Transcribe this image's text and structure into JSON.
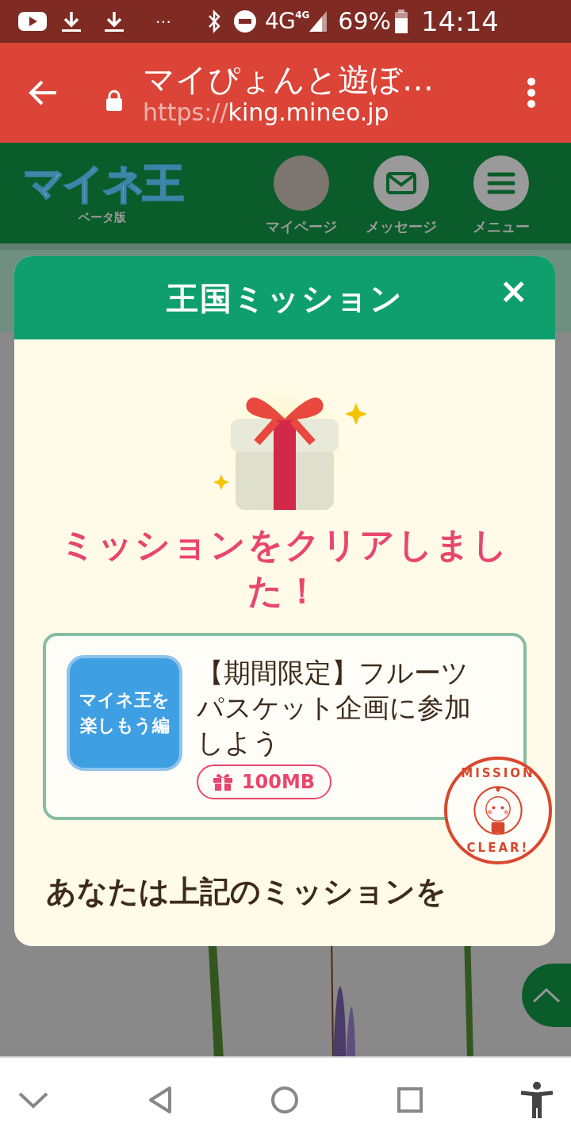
{
  "status_bar": {
    "notification_dots": "⋯",
    "network": "4G",
    "network_small": "4G",
    "battery": "69%",
    "time": "14:14"
  },
  "browser": {
    "title": "マイぴょんと遊ぼ…",
    "url_scheme": "https://",
    "url_host": "king.mineo.jp"
  },
  "site_header": {
    "logo": "マイネ王",
    "logo_sub": "ベータ版",
    "nav": [
      {
        "kind": "avatar",
        "label": "マイページ"
      },
      {
        "kind": "mail",
        "label": "メッセージ"
      },
      {
        "kind": "menu",
        "label": "メニュー"
      }
    ]
  },
  "modal": {
    "title": "王国ミッション",
    "close": "×",
    "heading": "ミッションをクリアしました！",
    "mission": {
      "badge": "マイネ王を楽しもう編",
      "title_lines": [
        "【期間限定】フルーツ",
        "パスケット企画に参加",
        "しよう"
      ],
      "reward": "100MB",
      "stamp_top": "MISSION",
      "stamp_bottom": "CLEAR!"
    },
    "message": "あなたは上記のミッションを"
  }
}
